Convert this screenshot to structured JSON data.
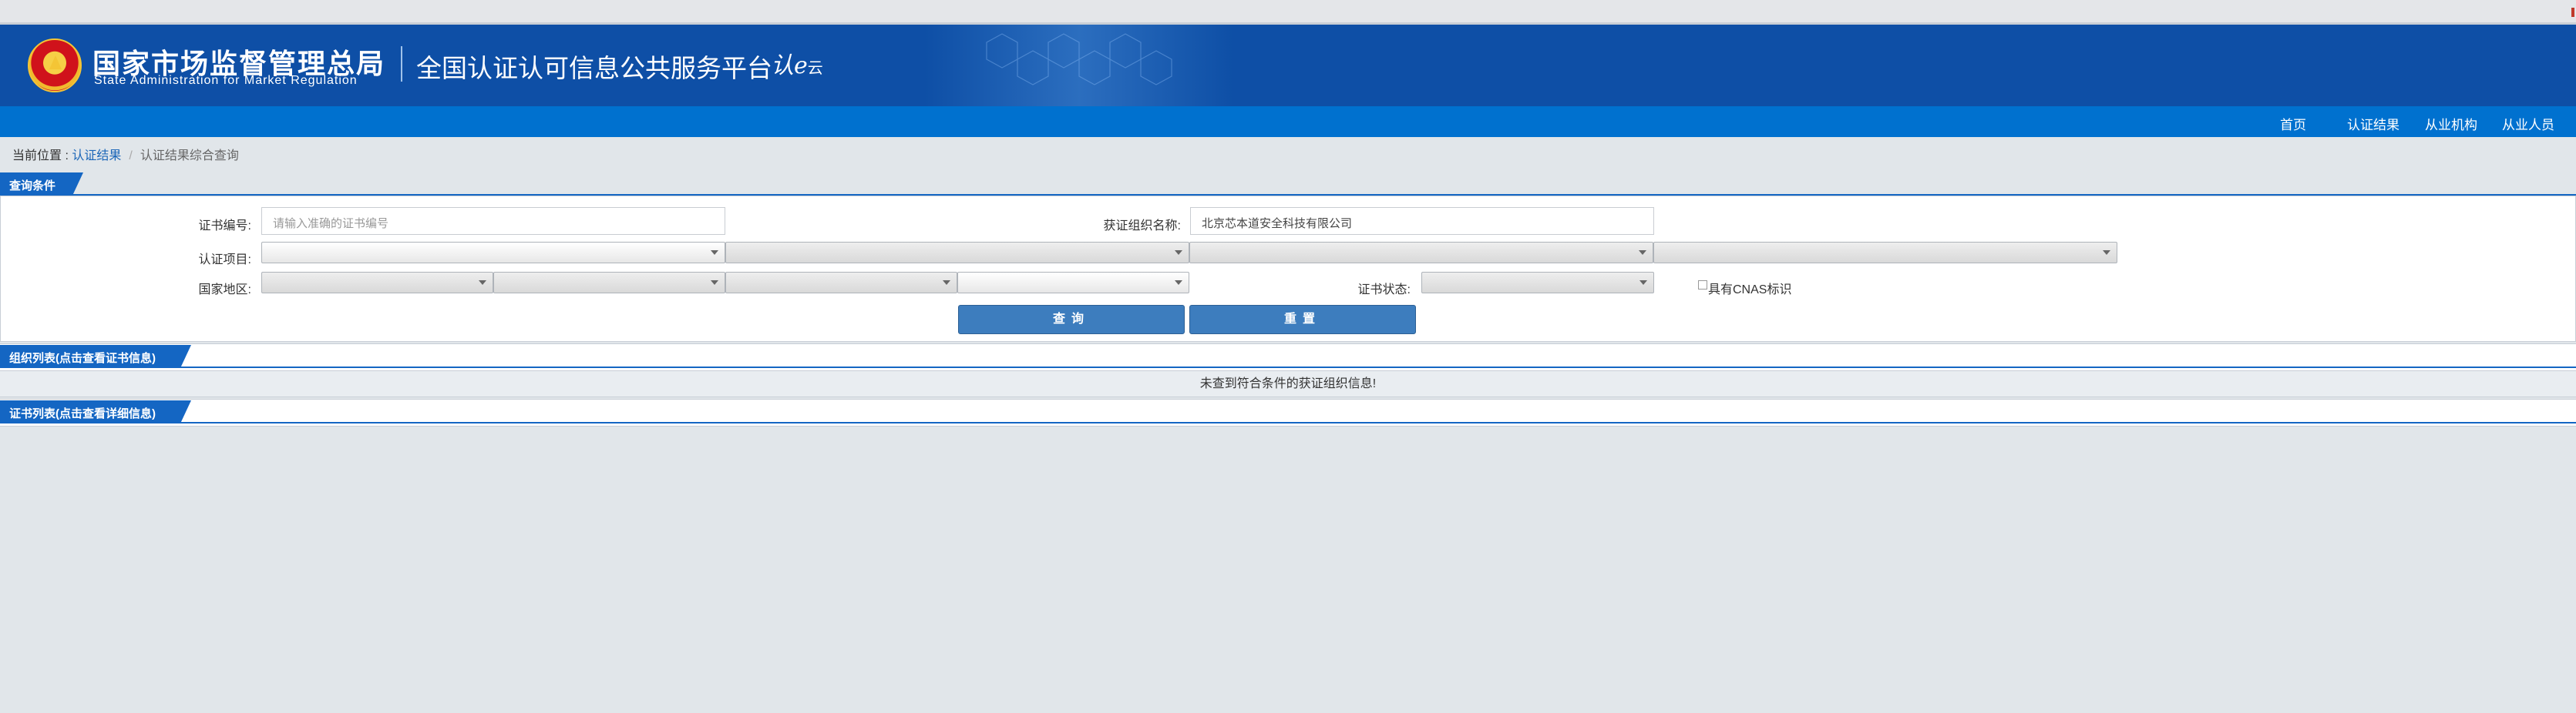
{
  "header": {
    "org_cn": "国家市场监督管理总局",
    "org_en": "State Administration  for  Market Regulation",
    "platform": "全国认证认可信息公共服务平台",
    "logo_text": "认e",
    "logo_sub": "云"
  },
  "nav": {
    "items": [
      {
        "label": "首页"
      },
      {
        "label": "认证结果"
      },
      {
        "label": "从业机构"
      },
      {
        "label": "从业人员"
      }
    ]
  },
  "breadcrumb": {
    "prefix": "当前位置 : ",
    "link": "认证结果",
    "separator": "/",
    "current": "认证结果综合查询"
  },
  "query": {
    "tab_label": "查询条件",
    "cert_no_label": "证书编号:",
    "cert_no_placeholder": "请输入准确的证书编号",
    "org_name_label": "获证组织名称:",
    "org_name_value": "北京芯本道安全科技有限公司",
    "project_label": "认证项目:",
    "region_label": "国家地区:",
    "status_label": "证书状态:",
    "cnas_label": "具有CNAS标识",
    "search_button": "查询",
    "reset_button": "重置"
  },
  "org_list": {
    "tab_label": "组织列表(点击查看证书信息)",
    "empty_message": "未查到符合条件的获证组织信息!"
  },
  "cert_list": {
    "tab_label": "证书列表(点击查看详细信息)"
  },
  "colors": {
    "header_bg": "#0e4fa6",
    "nav_bg": "#0071cf",
    "tab_bg": "#1466c3",
    "button_bg": "#3d7dbe",
    "page_bg": "#e1e6ea"
  }
}
